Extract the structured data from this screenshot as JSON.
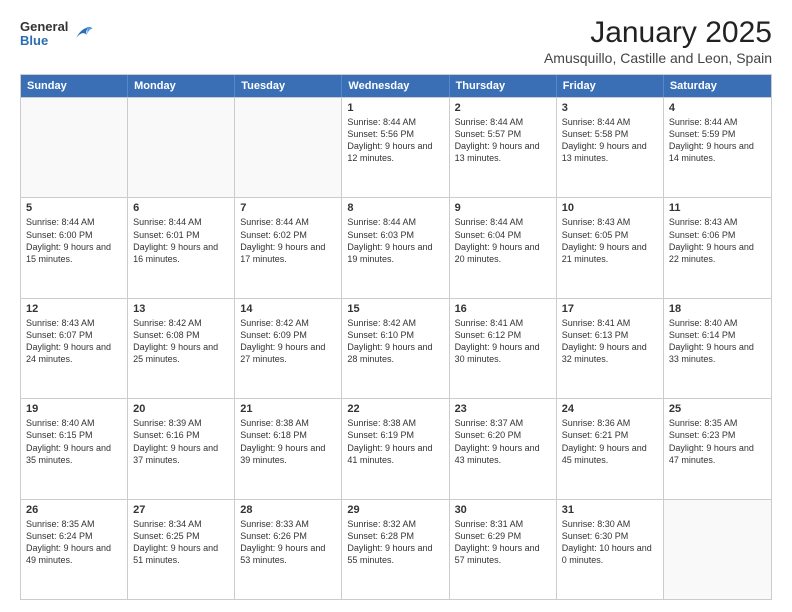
{
  "header": {
    "logo_general": "General",
    "logo_blue": "Blue",
    "title": "January 2025",
    "subtitle": "Amusquillo, Castille and Leon, Spain"
  },
  "calendar": {
    "days_of_week": [
      "Sunday",
      "Monday",
      "Tuesday",
      "Wednesday",
      "Thursday",
      "Friday",
      "Saturday"
    ],
    "rows": [
      [
        {
          "day": "",
          "info": ""
        },
        {
          "day": "",
          "info": ""
        },
        {
          "day": "",
          "info": ""
        },
        {
          "day": "1",
          "info": "Sunrise: 8:44 AM\nSunset: 5:56 PM\nDaylight: 9 hours and 12 minutes."
        },
        {
          "day": "2",
          "info": "Sunrise: 8:44 AM\nSunset: 5:57 PM\nDaylight: 9 hours and 13 minutes."
        },
        {
          "day": "3",
          "info": "Sunrise: 8:44 AM\nSunset: 5:58 PM\nDaylight: 9 hours and 13 minutes."
        },
        {
          "day": "4",
          "info": "Sunrise: 8:44 AM\nSunset: 5:59 PM\nDaylight: 9 hours and 14 minutes."
        }
      ],
      [
        {
          "day": "5",
          "info": "Sunrise: 8:44 AM\nSunset: 6:00 PM\nDaylight: 9 hours and 15 minutes."
        },
        {
          "day": "6",
          "info": "Sunrise: 8:44 AM\nSunset: 6:01 PM\nDaylight: 9 hours and 16 minutes."
        },
        {
          "day": "7",
          "info": "Sunrise: 8:44 AM\nSunset: 6:02 PM\nDaylight: 9 hours and 17 minutes."
        },
        {
          "day": "8",
          "info": "Sunrise: 8:44 AM\nSunset: 6:03 PM\nDaylight: 9 hours and 19 minutes."
        },
        {
          "day": "9",
          "info": "Sunrise: 8:44 AM\nSunset: 6:04 PM\nDaylight: 9 hours and 20 minutes."
        },
        {
          "day": "10",
          "info": "Sunrise: 8:43 AM\nSunset: 6:05 PM\nDaylight: 9 hours and 21 minutes."
        },
        {
          "day": "11",
          "info": "Sunrise: 8:43 AM\nSunset: 6:06 PM\nDaylight: 9 hours and 22 minutes."
        }
      ],
      [
        {
          "day": "12",
          "info": "Sunrise: 8:43 AM\nSunset: 6:07 PM\nDaylight: 9 hours and 24 minutes."
        },
        {
          "day": "13",
          "info": "Sunrise: 8:42 AM\nSunset: 6:08 PM\nDaylight: 9 hours and 25 minutes."
        },
        {
          "day": "14",
          "info": "Sunrise: 8:42 AM\nSunset: 6:09 PM\nDaylight: 9 hours and 27 minutes."
        },
        {
          "day": "15",
          "info": "Sunrise: 8:42 AM\nSunset: 6:10 PM\nDaylight: 9 hours and 28 minutes."
        },
        {
          "day": "16",
          "info": "Sunrise: 8:41 AM\nSunset: 6:12 PM\nDaylight: 9 hours and 30 minutes."
        },
        {
          "day": "17",
          "info": "Sunrise: 8:41 AM\nSunset: 6:13 PM\nDaylight: 9 hours and 32 minutes."
        },
        {
          "day": "18",
          "info": "Sunrise: 8:40 AM\nSunset: 6:14 PM\nDaylight: 9 hours and 33 minutes."
        }
      ],
      [
        {
          "day": "19",
          "info": "Sunrise: 8:40 AM\nSunset: 6:15 PM\nDaylight: 9 hours and 35 minutes."
        },
        {
          "day": "20",
          "info": "Sunrise: 8:39 AM\nSunset: 6:16 PM\nDaylight: 9 hours and 37 minutes."
        },
        {
          "day": "21",
          "info": "Sunrise: 8:38 AM\nSunset: 6:18 PM\nDaylight: 9 hours and 39 minutes."
        },
        {
          "day": "22",
          "info": "Sunrise: 8:38 AM\nSunset: 6:19 PM\nDaylight: 9 hours and 41 minutes."
        },
        {
          "day": "23",
          "info": "Sunrise: 8:37 AM\nSunset: 6:20 PM\nDaylight: 9 hours and 43 minutes."
        },
        {
          "day": "24",
          "info": "Sunrise: 8:36 AM\nSunset: 6:21 PM\nDaylight: 9 hours and 45 minutes."
        },
        {
          "day": "25",
          "info": "Sunrise: 8:35 AM\nSunset: 6:23 PM\nDaylight: 9 hours and 47 minutes."
        }
      ],
      [
        {
          "day": "26",
          "info": "Sunrise: 8:35 AM\nSunset: 6:24 PM\nDaylight: 9 hours and 49 minutes."
        },
        {
          "day": "27",
          "info": "Sunrise: 8:34 AM\nSunset: 6:25 PM\nDaylight: 9 hours and 51 minutes."
        },
        {
          "day": "28",
          "info": "Sunrise: 8:33 AM\nSunset: 6:26 PM\nDaylight: 9 hours and 53 minutes."
        },
        {
          "day": "29",
          "info": "Sunrise: 8:32 AM\nSunset: 6:28 PM\nDaylight: 9 hours and 55 minutes."
        },
        {
          "day": "30",
          "info": "Sunrise: 8:31 AM\nSunset: 6:29 PM\nDaylight: 9 hours and 57 minutes."
        },
        {
          "day": "31",
          "info": "Sunrise: 8:30 AM\nSunset: 6:30 PM\nDaylight: 10 hours and 0 minutes."
        },
        {
          "day": "",
          "info": ""
        }
      ]
    ]
  }
}
